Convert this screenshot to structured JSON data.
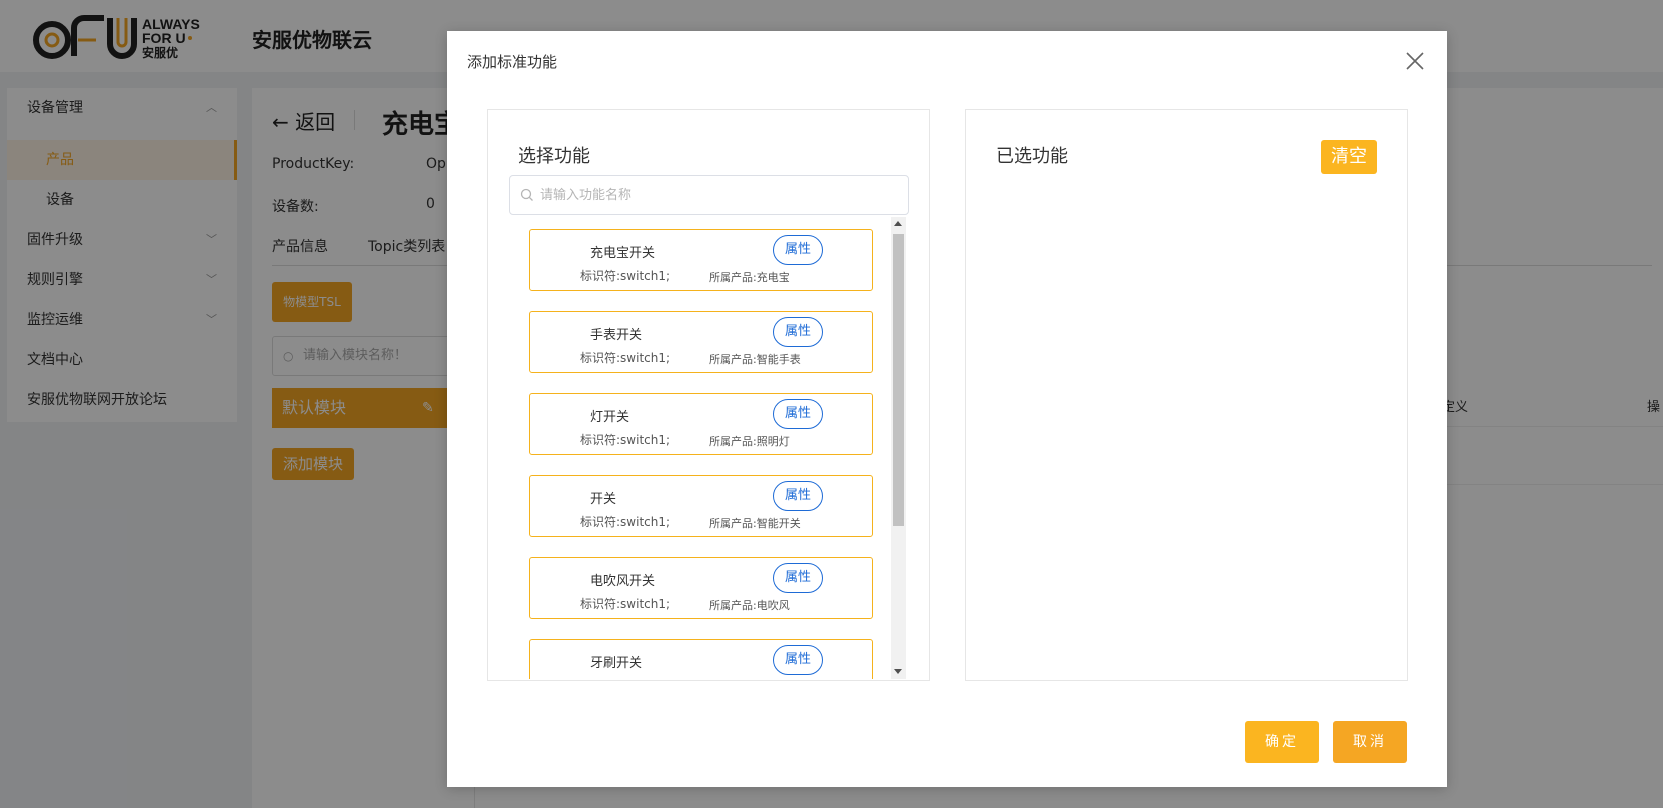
{
  "header": {
    "logo_text": "AFU ALWAYS FOR U 安服优",
    "brand_name": "安服优物联云"
  },
  "sidebar": {
    "items": [
      {
        "label": "设备管理",
        "chevron": "chevron-up"
      },
      {
        "label": "产品"
      },
      {
        "label": "设备"
      },
      {
        "label": "固件升级",
        "chevron": "chevron-down"
      },
      {
        "label": "规则引擎",
        "chevron": "chevron-down"
      },
      {
        "label": "监控运维",
        "chevron": "chevron-down"
      },
      {
        "label": "文档中心"
      },
      {
        "label": "安服优物联网开放论坛"
      }
    ],
    "active_item": "产品"
  },
  "page": {
    "back_label": "返回",
    "product_title": "充电宝",
    "product_key_label": "ProductKey:",
    "product_key_value": "Op",
    "device_count_label": "设备数:",
    "device_count_value": "0",
    "tabs": [
      "产品信息",
      "Topic类列表"
    ],
    "tsl_button": "物模型TSL",
    "module_search_placeholder": "请输入模块名称！",
    "default_module": "默认模块",
    "add_module_button": "添加模块",
    "col_definition": "定义",
    "col_operation": "操"
  },
  "modal": {
    "title": "添加标准功能",
    "left_panel_title": "选择功能",
    "search_placeholder": "请输入功能名称",
    "search_value": "",
    "right_panel_title": "已选功能",
    "clear_button": "清空",
    "confirm_button": "确定",
    "cancel_button": "取消",
    "functions": [
      {
        "name": "充电宝开关",
        "tag": "属性",
        "identifier": "标识符:switch1;",
        "product": "所属产品:充电宝"
      },
      {
        "name": "手表开关",
        "tag": "属性",
        "identifier": "标识符:switch1;",
        "product": "所属产品:智能手表"
      },
      {
        "name": "灯开关",
        "tag": "属性",
        "identifier": "标识符:switch1;",
        "product": "所属产品:照明灯"
      },
      {
        "name": "开关",
        "tag": "属性",
        "identifier": "标识符:switch1;",
        "product": "所属产品:智能开关"
      },
      {
        "name": "电吹风开关",
        "tag": "属性",
        "identifier": "标识符:switch1;",
        "product": "所属产品:电吹风"
      },
      {
        "name": "牙刷开关",
        "tag": "属性",
        "identifier": "",
        "product": ""
      }
    ],
    "scroll_position": 0
  },
  "colors": {
    "accent": "#f5a623",
    "accent_light": "#fbb520",
    "tag_blue": "#1e6bd6",
    "overlay": "rgba(0,0,0,0.45)"
  }
}
